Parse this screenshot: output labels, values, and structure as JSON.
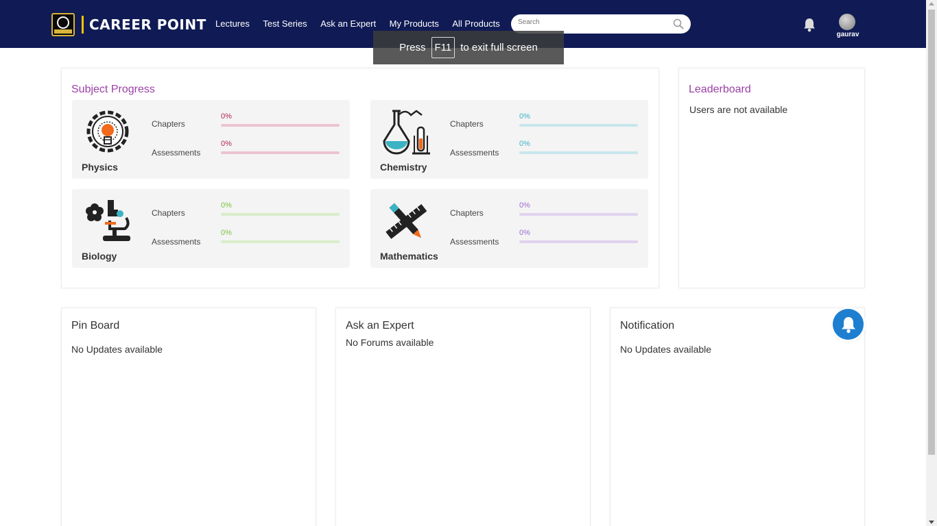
{
  "brand": {
    "name": "CAREER POINT",
    "badge_text": "CAREER POINT"
  },
  "nav": [
    "Lectures",
    "Test Series",
    "Ask an Expert",
    "My Products",
    "All Products"
  ],
  "search": {
    "placeholder": "Search",
    "icon": "search-icon"
  },
  "user": {
    "name": "gaurav"
  },
  "fullscreen_toast": {
    "before": "Press",
    "key": "F11",
    "after": "to exit full screen"
  },
  "subject_progress": {
    "title": "Subject Progress",
    "row_labels": {
      "chapters": "Chapters",
      "assessments": "Assessments"
    },
    "subjects": [
      {
        "name": "Physics",
        "icon": "lightbulb-gear-icon",
        "chapters": "0%",
        "assessments": "0%",
        "chapters_fraction": 0,
        "assessments_fraction": 0,
        "color": "#b0264f",
        "track": "#ecc3d1"
      },
      {
        "name": "Chemistry",
        "icon": "flask-icon",
        "chapters": "0%",
        "assessments": "0%",
        "chapters_fraction": 0,
        "assessments_fraction": 0,
        "color": "#3bb3c3",
        "track": "#c7e7ec"
      },
      {
        "name": "Biology",
        "icon": "microscope-icon",
        "chapters": "0%",
        "assessments": "0%",
        "chapters_fraction": 0,
        "assessments_fraction": 0,
        "color": "#7dc242",
        "track": "#d8ecc9"
      },
      {
        "name": "Mathematics",
        "icon": "ruler-pencil-icon",
        "chapters": "0%",
        "assessments": "0%",
        "chapters_fraction": 0,
        "assessments_fraction": 0,
        "color": "#9b6ad0",
        "track": "#e0d3ee"
      }
    ]
  },
  "leaderboard": {
    "title": "Leaderboard",
    "message": "Users are not available"
  },
  "pin_board": {
    "title": "Pin Board",
    "message": "No Updates available"
  },
  "ask_expert": {
    "title": "Ask an Expert",
    "message": "No Forums available"
  },
  "notification": {
    "title": "Notification",
    "message": "No Updates available"
  },
  "colors": {
    "header": "#101b55",
    "accent_purple": "#9a3fa6",
    "fab": "#1e7fd0"
  }
}
